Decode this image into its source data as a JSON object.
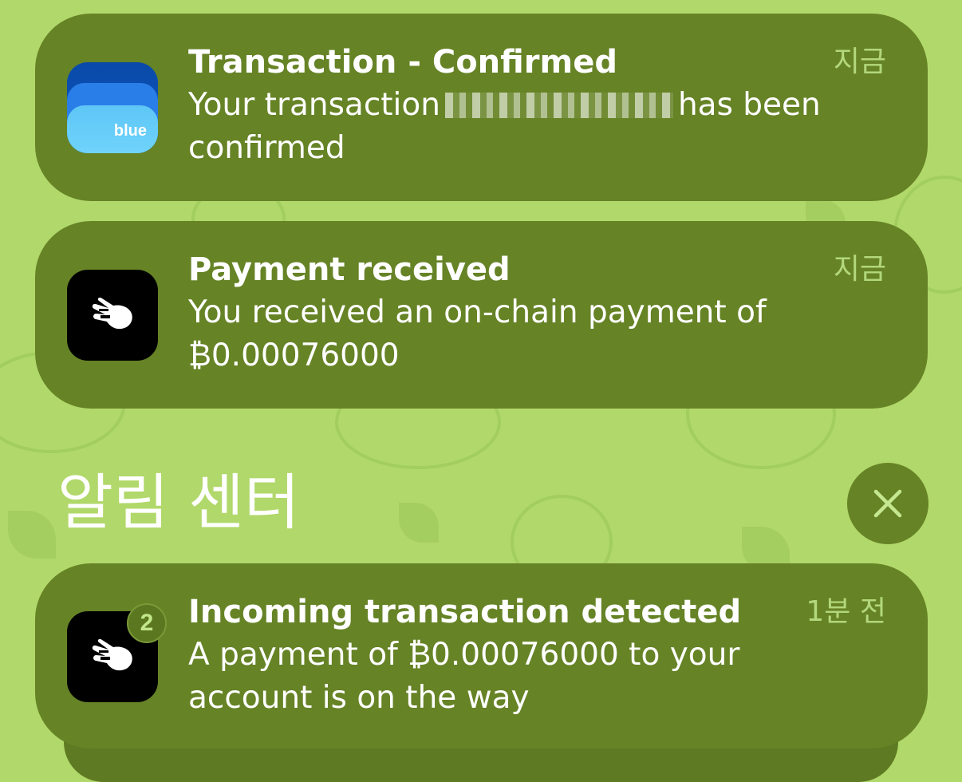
{
  "notifications": [
    {
      "app_icon": "bluewallet-icon",
      "icon_label": "blue",
      "title": "Transaction - Confirmed",
      "time": "지금",
      "body_before": "Your transaction",
      "body_after": "has been confirmed"
    },
    {
      "app_icon": "hand-wallet-icon",
      "title": "Payment received",
      "time": "지금",
      "body": "You received an on-chain payment of ₿0.00076000"
    }
  ],
  "section": {
    "title": "알림 센터",
    "close_icon": "close-icon"
  },
  "stacked": {
    "app_icon": "hand-wallet-icon",
    "badge": "2",
    "title": "Incoming transaction detected",
    "time": "1분 전",
    "body": "A payment of ₿0.00076000 to your account is on the way"
  },
  "colors": {
    "background": "#b1d86a",
    "card": "#668326",
    "time_text": "#b3d77c"
  }
}
